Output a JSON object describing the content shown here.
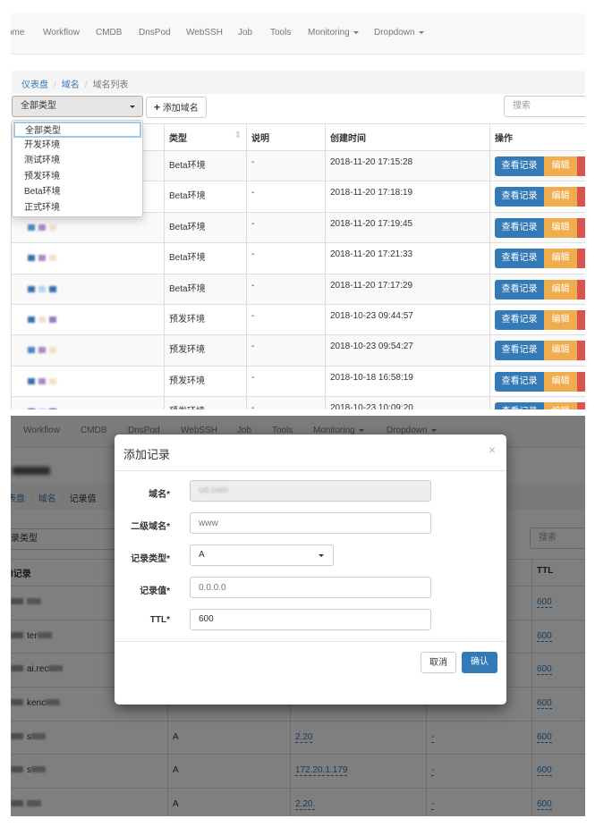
{
  "nav": {
    "items": [
      "ome",
      "Workflow",
      "CMDB",
      "DnsPod",
      "WebSSH",
      "Job",
      "Tools",
      "Monitoring",
      "Dropdown"
    ]
  },
  "domain_list": {
    "breadcrumb": [
      "仪表盘",
      "域名",
      "域名列表"
    ],
    "filter_select": {
      "value": "全部类型",
      "options": [
        "全部类型",
        "开发环境",
        "测试环境",
        "预发环境",
        "Beta环境",
        "正式环境"
      ]
    },
    "add_button": "添加域名",
    "search_placeholder": "搜索",
    "columns": [
      "类型",
      "说明",
      "创建时间",
      "操作"
    ],
    "rows": [
      {
        "type": "Beta环境",
        "desc": "-",
        "created": "2018-11-20 17:15:28"
      },
      {
        "type": "Beta环境",
        "desc": "-",
        "created": "2018-11-20 17:18:19"
      },
      {
        "type": "Beta环境",
        "desc": "-",
        "created": "2018-11-20 17:19:45"
      },
      {
        "type": "Beta环境",
        "desc": "-",
        "created": "2018-11-20 17:21:33"
      },
      {
        "type": "Beta环境",
        "desc": "-",
        "created": "2018-11-20 17:17:29"
      },
      {
        "type": "预发环境",
        "desc": "-",
        "created": "2018-10-23 09:44:57"
      },
      {
        "type": "预发环境",
        "desc": "-",
        "created": "2018-10-23 09:54:27"
      },
      {
        "type": "预发环境",
        "desc": "-",
        "created": "2018-10-18 16:58:19"
      },
      {
        "type": "预发环境",
        "desc": "-",
        "created": "2018-10-23 10:09:20"
      }
    ],
    "actions": {
      "view": "查看记录",
      "edit": "编辑"
    }
  },
  "record_page": {
    "breadcrumb": [
      "表盘",
      "域名",
      "记录值"
    ],
    "filter_label": "录类型",
    "search_placeholder": "搜索",
    "columns": {
      "first": "l记录",
      "ttl": "TTL"
    },
    "rows": [
      {
        "name": "",
        "type": "",
        "value": "",
        "ttl": "600"
      },
      {
        "name": "ter",
        "type": "",
        "value": "",
        "ttl": "600"
      },
      {
        "name": "ai.rec",
        "type": "",
        "value": "",
        "ttl": "600"
      },
      {
        "name": "kenc",
        "type": "",
        "value": "",
        "ttl": "600"
      },
      {
        "name": "s",
        "type": "A",
        "value": "2.20",
        "remark": "-",
        "ttl": "600"
      },
      {
        "name": "s",
        "type": "A",
        "value": "172.20.1.179",
        "remark": "-",
        "ttl": "600"
      },
      {
        "name": "",
        "type": "A",
        "value": "2.20.",
        "remark": "-",
        "ttl": "600"
      }
    ]
  },
  "modal": {
    "title": "添加记录",
    "close": "×",
    "fields": {
      "domain": {
        "label": "域名*",
        "value": "ud.com"
      },
      "subdomain": {
        "label": "二级域名*",
        "placeholder": "www"
      },
      "record_type": {
        "label": "记录类型*",
        "value": "A"
      },
      "record_value": {
        "label": "记录值*",
        "placeholder": "0.0.0.0"
      },
      "ttl": {
        "label": "TTL*",
        "value": "600"
      }
    },
    "cancel": "取消",
    "confirm": "确认"
  },
  "colors": {
    "primary": "#337ab7",
    "warning": "#f0ad4e",
    "danger": "#d9534f"
  }
}
